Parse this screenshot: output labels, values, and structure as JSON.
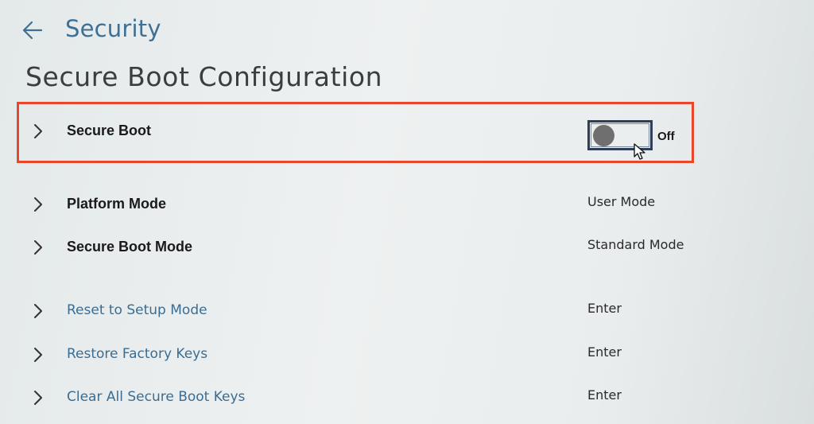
{
  "header": {
    "breadcrumb": "Security",
    "title": "Secure Boot Configuration"
  },
  "rows": [
    {
      "label": "Secure Boot",
      "value": "Off",
      "control": "toggle",
      "toggle_on": false
    },
    {
      "label": "Platform Mode",
      "value": "User Mode"
    },
    {
      "label": "Secure Boot Mode",
      "value": "Standard Mode"
    },
    {
      "label": "Reset to Setup Mode",
      "value": "Enter"
    },
    {
      "label": "Restore Factory Keys",
      "value": "Enter"
    },
    {
      "label": "Clear All Secure Boot Keys",
      "value": "Enter"
    }
  ],
  "icons": {
    "back": "arrow-left-icon",
    "row_expand": "chevron-right-icon",
    "pointer": "mouse-cursor-icon"
  },
  "colors": {
    "highlight_border": "#e8472d",
    "link_text": "#3a6d93",
    "breadcrumb_text": "#3f6f93",
    "toggle_border": "#2e3e58",
    "toggle_knob": "#6f6f6f"
  }
}
